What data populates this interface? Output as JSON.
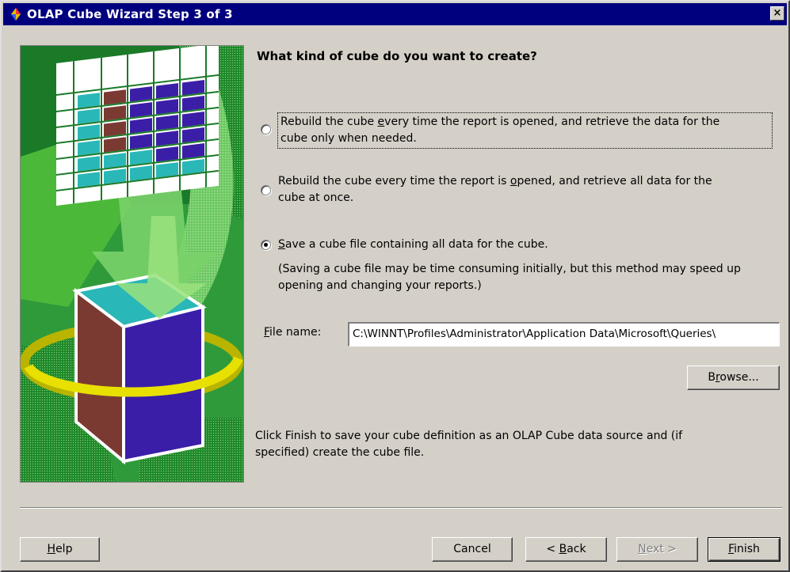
{
  "window": {
    "title": "OLAP Cube Wizard Step 3 of 3",
    "close_label": "×"
  },
  "main": {
    "heading": "What kind of cube do you want to create?",
    "options": [
      {
        "line1_pre": "Rebuild the cube ",
        "line1_key": "e",
        "line1_post": "very time the report is opened, and retrieve the data for the",
        "line2": "cube only when needed.",
        "selected": false
      },
      {
        "line1_pre": "Rebuild the cube every time the report is ",
        "line1_key": "o",
        "line1_post": "pened, and retrieve all data for the",
        "line2": "cube at once.",
        "selected": false
      },
      {
        "line1_pre": "",
        "line1_key": "S",
        "line1_post": "ave a cube file containing all data for the cube.",
        "line2": "(Saving a cube file may be time consuming initially, but this method may speed up",
        "line3": "opening and changing your reports.)",
        "selected": true
      }
    ],
    "file_name": {
      "label_key": "F",
      "label_rest": "ile name:",
      "value": "C:\\WINNT\\Profiles\\Administrator\\Application Data\\Microsoft\\Queries\\"
    },
    "browse_label_pre": "B",
    "browse_label_key": "r",
    "browse_label_post": "owse...",
    "finish_note_line1": "Click Finish to save your cube definition as an OLAP Cube data source and (if",
    "finish_note_line2": "specified) create the cube file."
  },
  "footer": {
    "help_key": "H",
    "help_rest": "elp",
    "cancel_label": "Cancel",
    "back_pre": "< ",
    "back_key": "B",
    "back_rest": "ack",
    "next_key": "N",
    "next_rest": "ext >",
    "finish_key": "F",
    "finish_rest": "inish"
  },
  "colors": {
    "titlebar": "#00007f",
    "dialog_bg": "#d4d0c8",
    "illustration_green": "#2f9a3a",
    "cube_teal": "#2ab7b7",
    "cube_brown": "#7a3a32",
    "cube_purple": "#3a1ea8",
    "ring_yellow": "#d8d400"
  }
}
